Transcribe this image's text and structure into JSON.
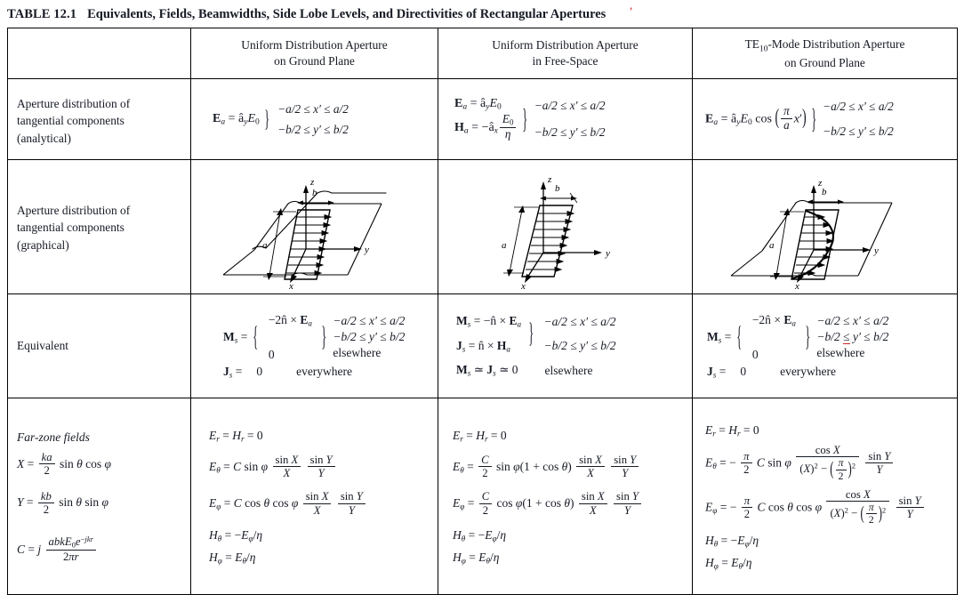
{
  "title": {
    "label": "TABLE 12.1",
    "text": "Equivalents, Fields, Beamwidths, Side Lobe Levels, and Directivities of Rectangular Apertures",
    "annotation_mark": "ʼ",
    "annotation_color": "#d02020"
  },
  "columns": [
    {
      "id": "rowlabel",
      "header_line1": "",
      "header_line2": ""
    },
    {
      "id": "uniform-ground-plane",
      "header_line1": "Uniform Distribution Aperture",
      "header_line2": "on Ground Plane"
    },
    {
      "id": "uniform-free-space",
      "header_line1": "Uniform Distribution Aperture",
      "header_line2": "in Free-Space"
    },
    {
      "id": "te10-ground-plane",
      "header_line1": "TE10-Mode Distribution Aperture",
      "header_line2": "on Ground Plane",
      "header_base": "TE",
      "header_sub": "10",
      "header_rest": "-Mode Distribution Aperture"
    }
  ],
  "rows": [
    {
      "id": "aperture-distribution-analytical",
      "label": "Aperture distribution of tangential components (analytical)",
      "label_lines": [
        "Aperture distribution of",
        "tangential components",
        "(analytical)"
      ],
      "cells": {
        "uniform_ground_plane": {
          "equations": [
            "E_a = â_y E_0"
          ],
          "conditions": [
            "−a/2 ≤ x′ ≤ a/2",
            "−b/2 ≤ y′ ≤ b/2"
          ]
        },
        "uniform_free_space": {
          "equations": [
            "E_a = â_y E_0",
            "H_a = −â_x E_0/η"
          ],
          "conditions": [
            "−a/2 ≤ x′ ≤ a/2",
            "−b/2 ≤ y′ ≤ b/2"
          ]
        },
        "te10_ground_plane": {
          "equations": [
            "E_a = â_y E_0 cos(π/a x′)"
          ],
          "conditions": [
            "−a/2 ≤ x′ ≤ a/2",
            "−b/2 ≤ y′ ≤ b/2"
          ]
        }
      }
    },
    {
      "id": "aperture-distribution-graphical",
      "label": "Aperture distribution of tangential components (graphical)",
      "label_lines": [
        "Aperture distribution of",
        "tangential components",
        "(graphical)"
      ],
      "cells": {
        "uniform_ground_plane": {
          "figure": "aperture-on-ground-plane-uniform",
          "axis_labels": [
            "z",
            "x",
            "y"
          ],
          "dimension_labels": [
            "a",
            "b"
          ],
          "has_ground_plane": true,
          "distribution": "uniform"
        },
        "uniform_free_space": {
          "figure": "aperture-free-space-uniform",
          "axis_labels": [
            "z",
            "x",
            "y"
          ],
          "dimension_labels": [
            "a",
            "b"
          ],
          "has_ground_plane": false,
          "distribution": "uniform"
        },
        "te10_ground_plane": {
          "figure": "aperture-on-ground-plane-te10",
          "axis_labels": [
            "z",
            "x",
            "y"
          ],
          "dimension_labels": [
            "a",
            "b"
          ],
          "has_ground_plane": true,
          "distribution": "cosine"
        }
      }
    },
    {
      "id": "equivalent",
      "label": "Equivalent",
      "cells": {
        "uniform_ground_plane": {
          "ms_cases": [
            "−2n̂ × E_a",
            "0"
          ],
          "ms_conditions": [
            "−a/2 ≤ x′ ≤ a/2",
            "−b/2 ≤ y′ ≤ b/2",
            "elsewhere"
          ],
          "js_value": "0",
          "js_condition": "everywhere"
        },
        "uniform_free_space": {
          "ms_equation": "M_s = −n̂ × E_a",
          "js_equation": "J_s = n̂ × H_a",
          "conditions": [
            "−a/2 ≤ x′ ≤ a/2",
            "−b/2 ≤ y′ ≤ b/2"
          ],
          "elsewhere_equation": "M_s ≃ J_s ≃ 0",
          "elsewhere_label": "elsewhere"
        },
        "te10_ground_plane": {
          "ms_cases": [
            "−2n̂ × E_a",
            "0"
          ],
          "ms_conditions": [
            "−a/2 ≤ x′ ≤ a/2",
            "−b/2 ≤ y′ ≤ b/2",
            "elsewhere"
          ],
          "js_value": "0",
          "js_condition": "everywhere",
          "red_underline_on": "−b/2 ≤ y′ ≤ b/2"
        }
      }
    },
    {
      "id": "far-zone-fields",
      "label": "Far-zone fields",
      "label_definitions": [
        "X = (ka/2) sin θ cos φ",
        "Y = (kb/2) sin θ sin φ",
        "C = j (abk E_0 e^{−jkr}) / (2πr)"
      ],
      "cells": {
        "uniform_ground_plane": {
          "lines": [
            "E_r = H_r = 0",
            "E_θ = C sin φ (sin X / X)(sin Y / Y)",
            "E_φ = C cos θ cos φ (sin X / X)(sin Y / Y)",
            "H_θ = −E_φ/η",
            "H_φ = E_θ/η"
          ]
        },
        "uniform_free_space": {
          "lines": [
            "E_r = H_r = 0",
            "E_θ = (C/2) sin φ (1 + cos θ)(sin X / X)(sin Y / Y)",
            "E_φ = (C/2) cos φ (1 + cos θ)(sin X / X)(sin Y / Y)",
            "H_θ = −E_φ/η",
            "H_φ = E_θ/η"
          ]
        },
        "te10_ground_plane": {
          "lines": [
            "E_r = H_r = 0",
            "E_θ = −(π/2) C sin φ · cos X / [(X)² − (π/2)²] · (sin Y / Y)",
            "E_φ = −(π/2) C cos θ cos φ · cos X / [(X)² − (π/2)²] · (sin Y / Y)",
            "H_θ = −E_φ/η",
            "H_φ = E_θ/η"
          ]
        }
      }
    }
  ],
  "symbols": {
    "eta": "η",
    "theta": "θ",
    "phi": "φ",
    "pi": "π",
    "leq": "≤",
    "approx": "≃",
    "times": "×",
    "minus": "−",
    "prime": "′",
    "hat_a": "â",
    "hat_n": "n̂"
  }
}
